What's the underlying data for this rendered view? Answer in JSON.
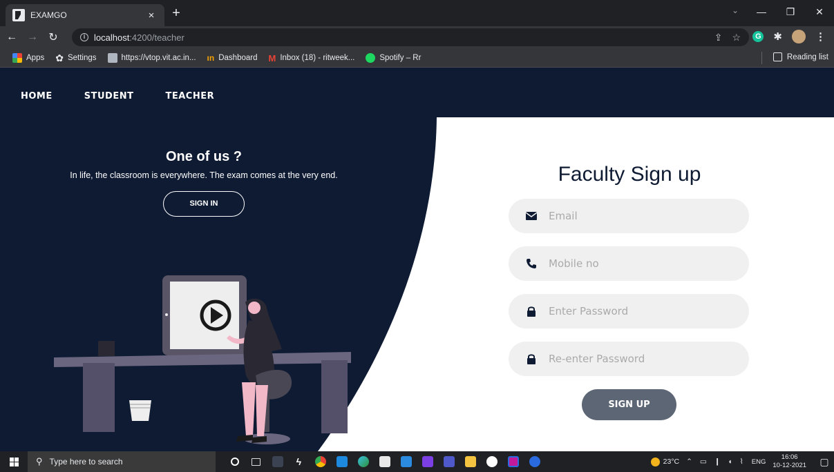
{
  "browser": {
    "tab_title": "EXAMGO",
    "tab_close": "×",
    "new_tab": "+",
    "url_host": "localhost",
    "url_path": ":4200/teacher",
    "bookmarks": [
      {
        "label": "Apps",
        "icon": "apps-icon"
      },
      {
        "label": "Settings",
        "icon": "gear-icon"
      },
      {
        "label": "https://vtop.vit.ac.in...",
        "icon": "vtop-icon"
      },
      {
        "label": "Dashboard",
        "icon": "dashboard-icon"
      },
      {
        "label": "Inbox (18) - ritweek...",
        "icon": "gmail-icon"
      },
      {
        "label": "Spotify – Rr",
        "icon": "spotify-icon"
      }
    ],
    "reading_list": "Reading list"
  },
  "nav": {
    "home": "HOME",
    "student": "STUDENT",
    "teacher": "TEACHER"
  },
  "left_panel": {
    "title": "One of us ?",
    "subtitle": "In life, the classroom is everywhere. The exam comes at the very end.",
    "signin_label": "SIGN IN"
  },
  "form": {
    "title": "Faculty Sign up",
    "email_placeholder": "Email",
    "mobile_placeholder": "Mobile no",
    "password_placeholder": "Enter Password",
    "repassword_placeholder": "Re-enter Password",
    "signup_label": "SIGN UP"
  },
  "taskbar": {
    "search_placeholder": "Type here to search",
    "temperature": "23°C",
    "language": "ENG",
    "time": "16:06",
    "date": "10-12-2021"
  },
  "colors": {
    "page_dark": "#0e1b33",
    "signup_button": "#5d6675",
    "field_bg": "#f0f0f0"
  }
}
